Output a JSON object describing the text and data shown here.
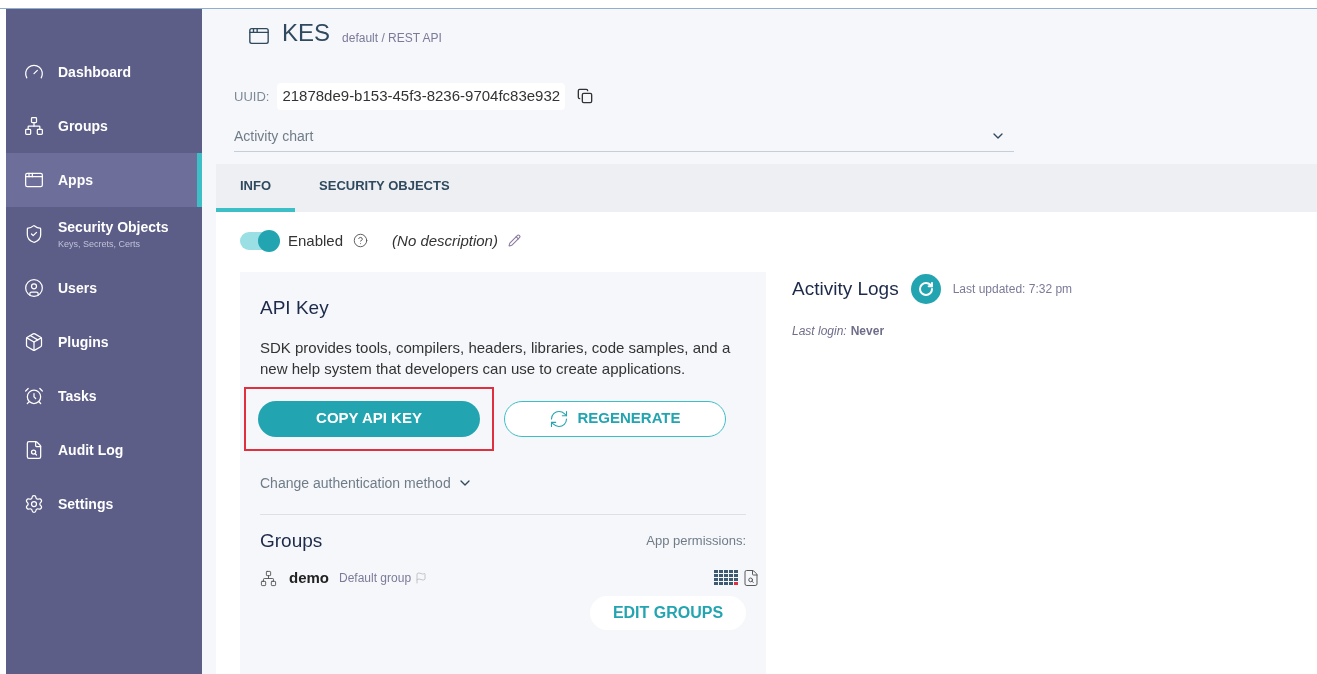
{
  "sidebar": {
    "items": [
      {
        "label": "Dashboard",
        "selected": false
      },
      {
        "label": "Groups",
        "selected": false
      },
      {
        "label": "Apps",
        "selected": true
      },
      {
        "label": "Security Objects",
        "subtitle": "Keys, Secrets, Certs",
        "selected": false
      },
      {
        "label": "Users",
        "selected": false
      },
      {
        "label": "Plugins",
        "selected": false
      },
      {
        "label": "Tasks",
        "selected": false
      },
      {
        "label": "Audit Log",
        "selected": false
      },
      {
        "label": "Settings",
        "selected": false
      }
    ]
  },
  "header": {
    "title": "KES",
    "path": "default / REST API",
    "uuid_label": "UUID:",
    "uuid": "21878de9-b153-45f3-8236-9704fc83e932",
    "dropdown": "Activity chart"
  },
  "tabs": [
    {
      "label": "INFO",
      "selected": true
    },
    {
      "label": "SECURITY OBJECTS",
      "selected": false
    }
  ],
  "status": {
    "label": "Enabled",
    "on": true,
    "description": "(No description)"
  },
  "api_key": {
    "title": "API Key",
    "text": "SDK provides tools, compilers, headers, libraries, code samples, and a new help system that developers can use to create applications.",
    "copy_button": "COPY API KEY",
    "copy_highlighted": true,
    "regenerate_button": "REGENERATE",
    "auth_link": "Change authentication method"
  },
  "groups": {
    "title": "Groups",
    "permissions_label": "App permissions:",
    "items": [
      {
        "name": "demo",
        "note": "Default group"
      }
    ],
    "edit_button": "EDIT GROUPS"
  },
  "activity": {
    "title": "Activity Logs",
    "updated": "Last updated: 7:32 pm",
    "login_label": "Last login:",
    "login_value": "Never"
  }
}
